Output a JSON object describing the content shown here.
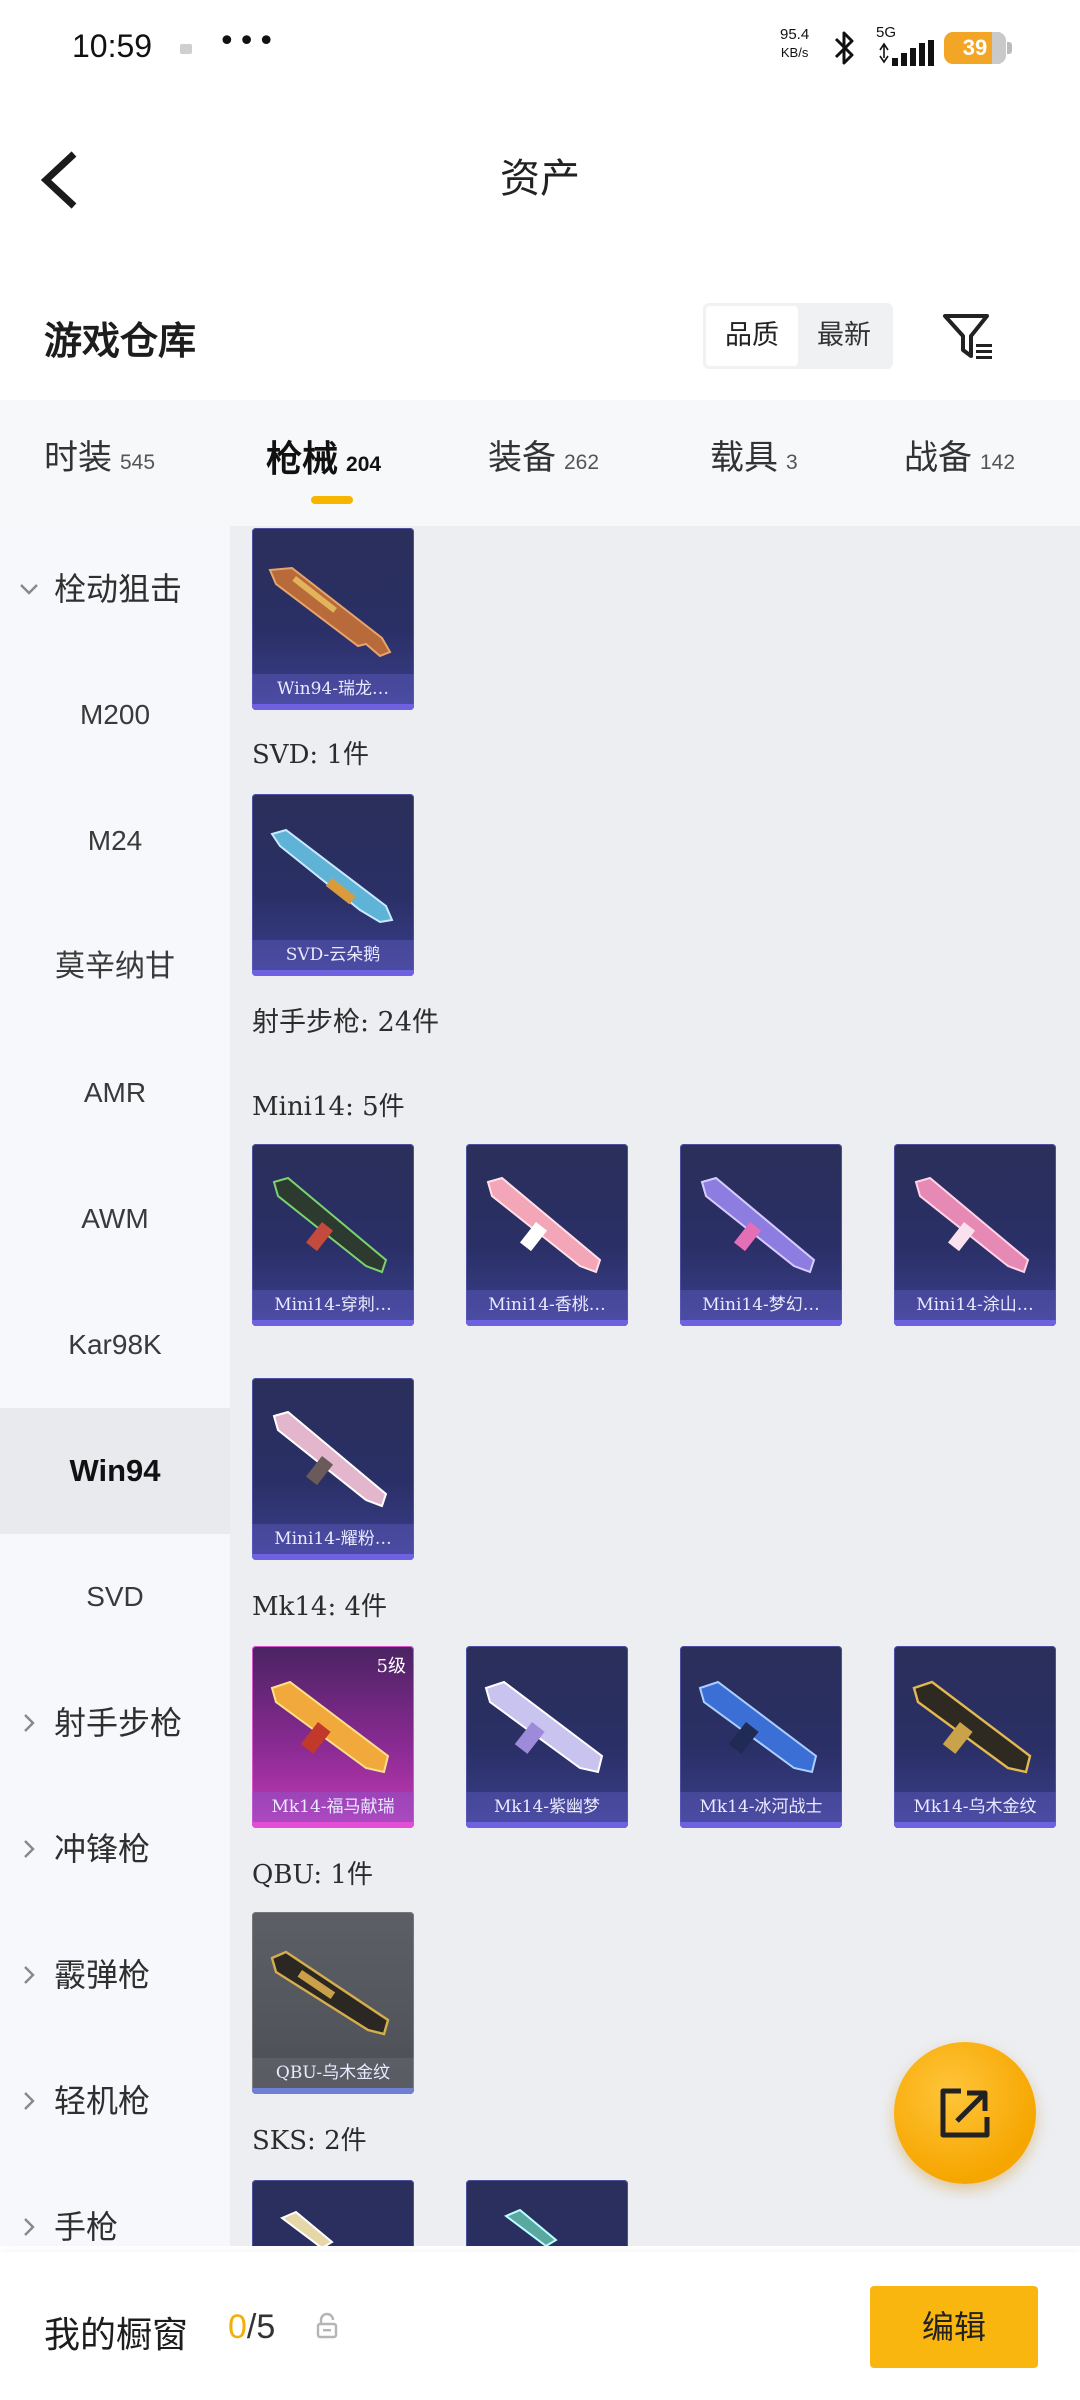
{
  "status_bar": {
    "time": "10:59",
    "more": "•••",
    "net_speed": "95.4",
    "net_unit": "KB/s",
    "network": "5G",
    "battery": "39"
  },
  "header": {
    "title": "资产",
    "back_icon": "chevron-left-icon"
  },
  "warehouse": {
    "title": "游戏仓库",
    "sort_options": [
      "品质",
      "最新"
    ],
    "sort_active": "品质",
    "filter_icon": "filter-icon"
  },
  "category_tabs": [
    {
      "label": "时装",
      "count": "545"
    },
    {
      "label": "枪械",
      "count": "204",
      "active": true
    },
    {
      "label": "装备",
      "count": "262"
    },
    {
      "label": "载具",
      "count": "3"
    },
    {
      "label": "战备",
      "count": "142"
    }
  ],
  "sidebar": {
    "items": [
      {
        "label": "栓动狙击",
        "type": "group-expanded"
      },
      {
        "label": "M200"
      },
      {
        "label": "M24"
      },
      {
        "label": "莫辛纳甘"
      },
      {
        "label": "AMR"
      },
      {
        "label": "AWM"
      },
      {
        "label": "Kar98K"
      },
      {
        "label": "Win94",
        "active": true
      },
      {
        "label": "SVD"
      },
      {
        "label": "射手步枪",
        "type": "group-collapsed"
      },
      {
        "label": "冲锋枪",
        "type": "group-collapsed"
      },
      {
        "label": "霰弹枪",
        "type": "group-collapsed"
      },
      {
        "label": "轻机枪",
        "type": "group-collapsed"
      },
      {
        "label": "手枪",
        "type": "group-collapsed"
      }
    ]
  },
  "content": {
    "win94_cards": [
      {
        "name": "Win94-瑞龙…"
      }
    ],
    "svd_label": "SVD: 1件",
    "svd_cards": [
      {
        "name": "SVD-云朵鹅"
      }
    ],
    "dmr_label": "射手步枪: 24件",
    "mini14_label": "Mini14: 5件",
    "mini14_cards": [
      {
        "name": "Mini14-穿刺…"
      },
      {
        "name": "Mini14-香桃…"
      },
      {
        "name": "Mini14-梦幻…"
      },
      {
        "name": "Mini14-涂山…"
      },
      {
        "name": "Mini14-耀粉…"
      }
    ],
    "mk14_label": "Mk14: 4件",
    "mk14_cards": [
      {
        "name": "Mk14-福马献瑞",
        "level": "5级",
        "rarity": "pink"
      },
      {
        "name": "Mk14-紫幽梦"
      },
      {
        "name": "Mk14-冰河战士"
      },
      {
        "name": "Mk14-乌木金纹"
      }
    ],
    "qbu_label": "QBU: 1件",
    "qbu_cards": [
      {
        "name": "QBU-乌木金纹",
        "rarity": "grey"
      }
    ],
    "sks_label": "SKS: 2件"
  },
  "fab": {
    "icon": "share-export-icon"
  },
  "bottom_bar": {
    "showcase_label": "我的橱窗",
    "showcase_used": "0",
    "showcase_total": "/5",
    "lock_icon": "lock-icon",
    "edit_label": "编辑"
  },
  "colors": {
    "accent": "#f9b60e",
    "sidebar_bg": "#f6f8fb",
    "content_bg": "#eceef1",
    "card_purple": "#2a2f66",
    "card_pink": "#c43bb4"
  }
}
